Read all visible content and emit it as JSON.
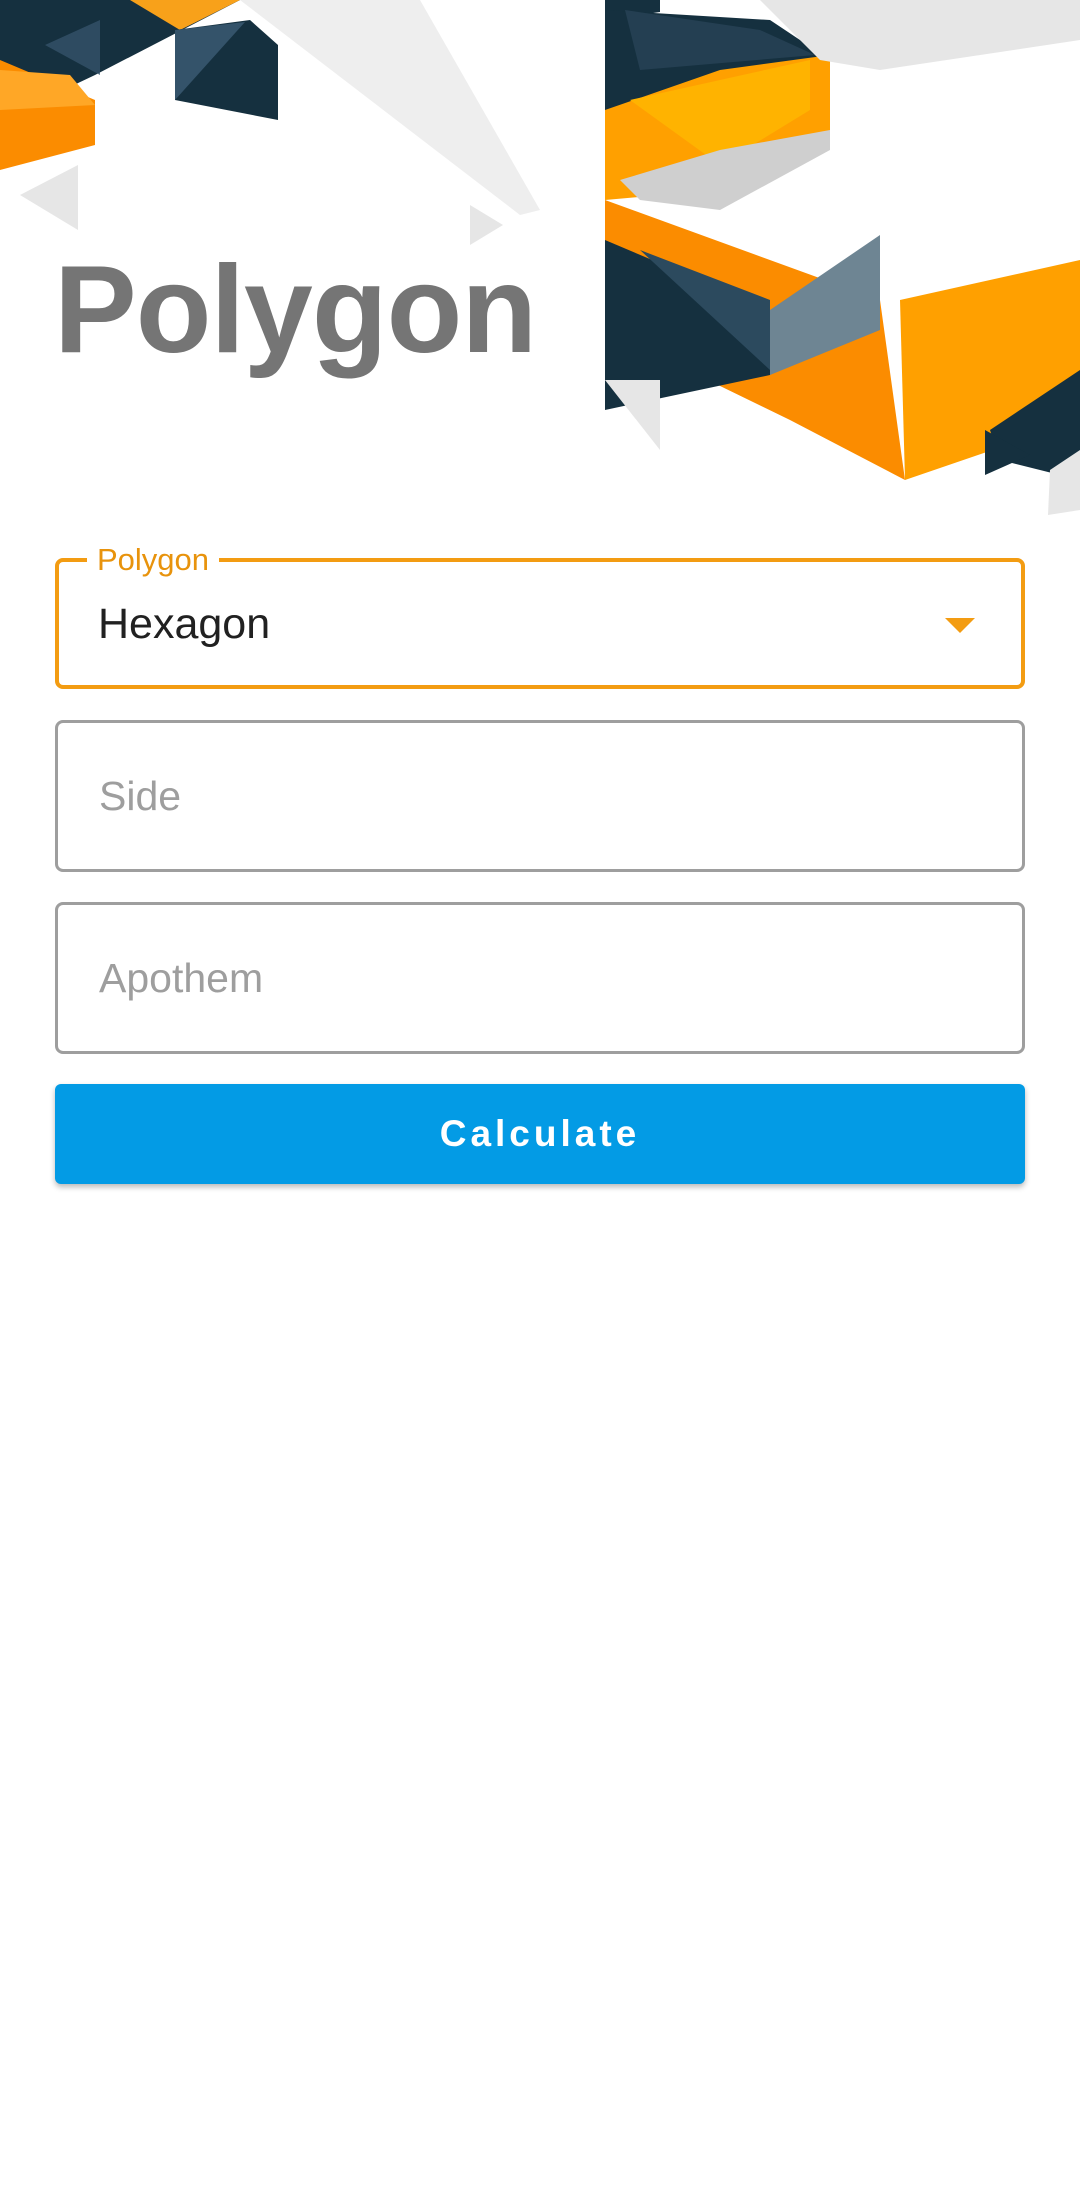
{
  "header": {
    "title": "Polygon",
    "artwork": "orange-navy-geometric-banner"
  },
  "form": {
    "polygon_select": {
      "label": "Polygon",
      "selected": "Hexagon",
      "icon": "dropdown-arrow-icon"
    },
    "side": {
      "placeholder": "Side",
      "value": ""
    },
    "apothem": {
      "placeholder": "Apothem",
      "value": ""
    },
    "calculate_label": "Calculate"
  },
  "colors": {
    "accent_orange": "#F39C12",
    "button_blue": "#039BE5",
    "title_gray": "#757575",
    "art_navy": "#15303F",
    "art_slate": "#34536A"
  }
}
